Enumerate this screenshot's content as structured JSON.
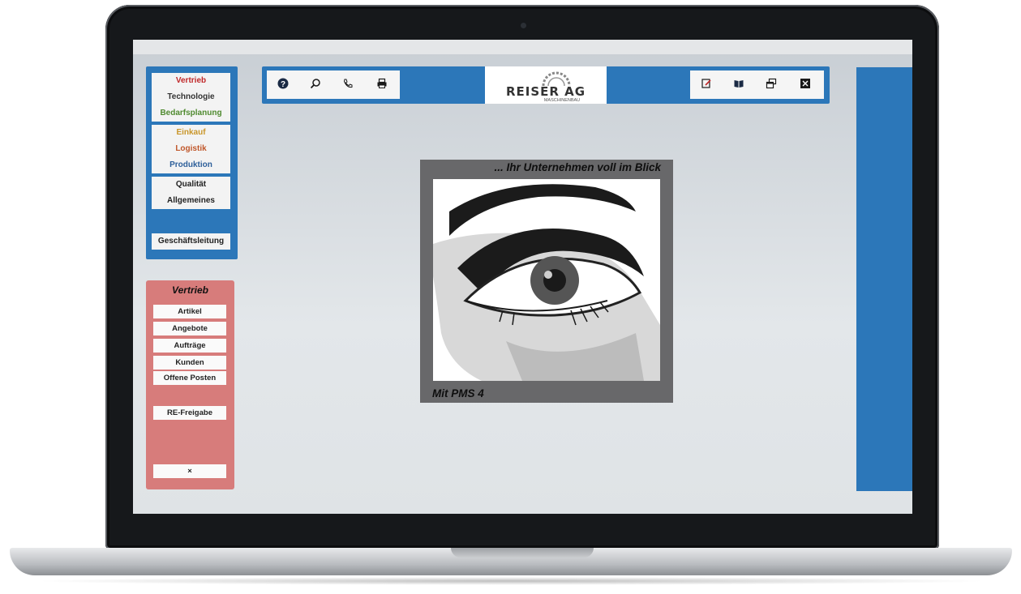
{
  "nav": {
    "items": [
      {
        "label": "Vertrieb",
        "color": "#c0282a"
      },
      {
        "label": "Technologie",
        "color": "#333333"
      },
      {
        "label": "Bedarfsplanung",
        "color": "#4f8a2f"
      },
      {
        "label": "Einkauf",
        "color": "#c9962a"
      },
      {
        "label": "Logistik",
        "color": "#c0572a"
      },
      {
        "label": "Produktion",
        "color": "#2d5f9a"
      },
      {
        "label": "Qualität",
        "color": "#222222"
      },
      {
        "label": "Allgemeines",
        "color": "#222222"
      }
    ],
    "management_label": "Geschäftsleitung"
  },
  "submenu": {
    "title": "Vertrieb",
    "items": [
      "Artikel",
      "Angebote",
      "Aufträge",
      "Kunden",
      "Offene Posten"
    ],
    "release_label": "RE-Freigabe",
    "close_label": "×"
  },
  "toolbar": {
    "left_icons": [
      "help-icon",
      "search-icon",
      "phone-icon",
      "print-icon"
    ],
    "right_icons": [
      "edit-icon",
      "book-icon",
      "windows-icon",
      "close-icon"
    ],
    "logo_name": "REISER AG",
    "logo_subtitle": "MASCHINENBAU",
    "accent_color": "#2c77b9"
  },
  "hero": {
    "top_caption": "... Ihr Unternehmen voll im Blick",
    "bottom_caption": "Mit PMS 4"
  }
}
